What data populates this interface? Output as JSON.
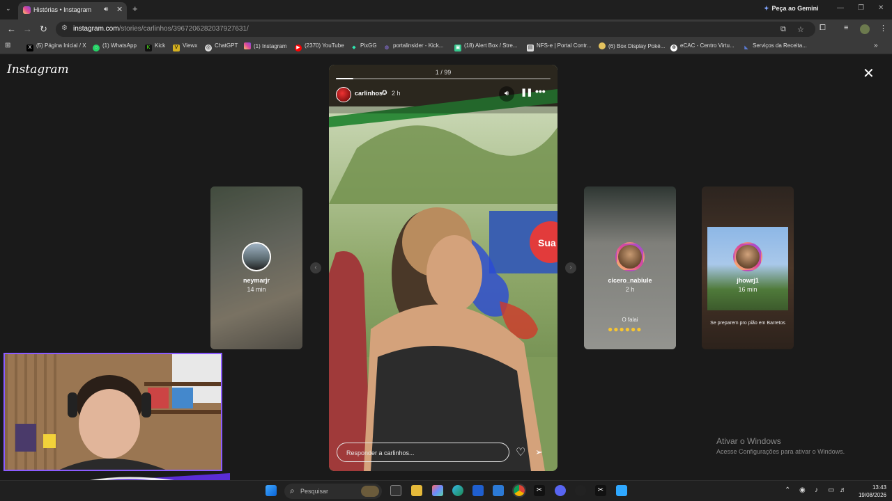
{
  "browser": {
    "tab_title": "Histórias • Instagram",
    "gemini_label": "Peça ao Gemini",
    "url_host": "instagram.com",
    "url_path": "/stories/carlinhos/3967206282037927631/",
    "bookmarks": [
      "(5) Página Inicial / X",
      "(1) WhatsApp",
      "Kick",
      "Viewx",
      "ChatGPT",
      "(1) Instagram",
      "(2370) YouTube",
      "PixGG",
      "portalinsider - Kick...",
      "(18) Alert Box / Stre...",
      "NFS-e | Portal Contr...",
      "(6) Box Display Poké...",
      "eCAC - Centro Virtu...",
      "Serviços da Receita..."
    ]
  },
  "instagram": {
    "logo": "Instagram",
    "story": {
      "counter": "1 / 99",
      "username": "carlinhos",
      "time": "2 h",
      "reply_placeholder": "Responder a carlinhos...",
      "progress": 0.08,
      "sign_text": "Sua"
    },
    "side_stories": [
      {
        "name": "neymarjr",
        "time": "14 min"
      },
      {
        "name": "cicero_nabiule",
        "time": "2 h",
        "caption": "O falai"
      },
      {
        "name": "jhowrj1",
        "time": "16 min",
        "caption": "Se preparem pro pião em Barretos"
      }
    ]
  },
  "windows": {
    "activate_title": "Ativar o Windows",
    "activate_sub": "Acesse Configurações para ativar o Windows.",
    "search_label": "Pesquisar",
    "time": "13:43",
    "date": "19/08/2026"
  },
  "colors": {
    "accent": "#8b5cff",
    "ig_bg": "#1a1a1a"
  }
}
